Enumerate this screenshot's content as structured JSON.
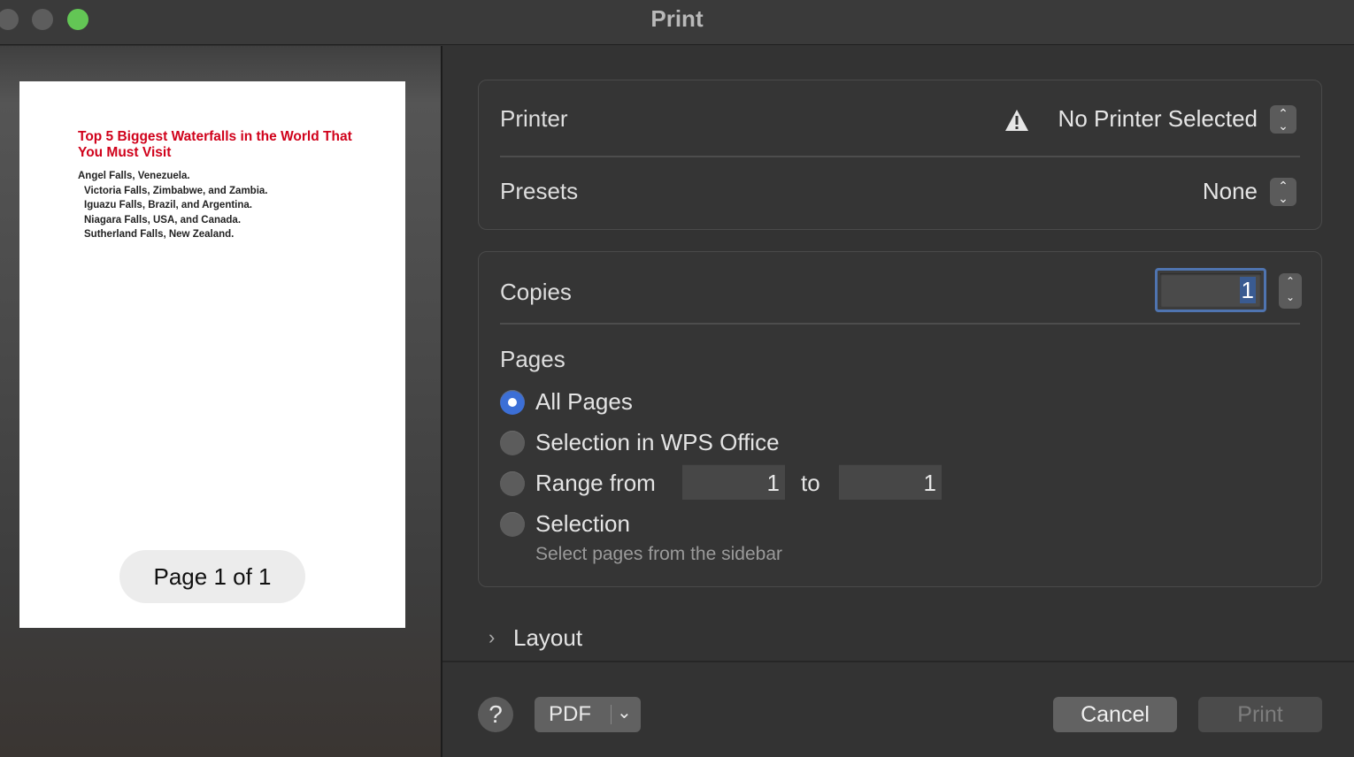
{
  "window": {
    "title": "Print"
  },
  "preview": {
    "doc_title": "Top 5 Biggest Waterfalls in the World That You Must Visit",
    "doc_lines": [
      "Angel Falls, Venezuela.",
      "Victoria Falls, Zimbabwe, and Zambia.",
      "Iguazu Falls, Brazil, and Argentina.",
      "Niagara Falls, USA, and Canada.",
      "Sutherland Falls, New Zealand."
    ],
    "page_indicator": "Page 1 of 1"
  },
  "printer": {
    "label": "Printer",
    "value": "No Printer Selected",
    "icon": "warning-icon"
  },
  "presets": {
    "label": "Presets",
    "value": "None"
  },
  "copies": {
    "label": "Copies",
    "value": "1"
  },
  "pages": {
    "label": "Pages",
    "options": [
      {
        "label": "All Pages",
        "selected": true
      },
      {
        "label": "Selection in WPS Office",
        "selected": false
      },
      {
        "label": "Range from",
        "selected": false
      },
      {
        "label": "Selection",
        "selected": false
      }
    ],
    "range_from": "1",
    "range_to_label": "to",
    "range_to": "1",
    "selection_hint": "Select pages from the sidebar"
  },
  "layout": {
    "label": "Layout"
  },
  "footer": {
    "help_label": "?",
    "pdf_label": "PDF",
    "cancel_label": "Cancel",
    "print_label": "Print"
  },
  "colors": {
    "accent": "#3c6fd6",
    "doc_title": "#d0021b",
    "traffic_green": "#63c655"
  }
}
